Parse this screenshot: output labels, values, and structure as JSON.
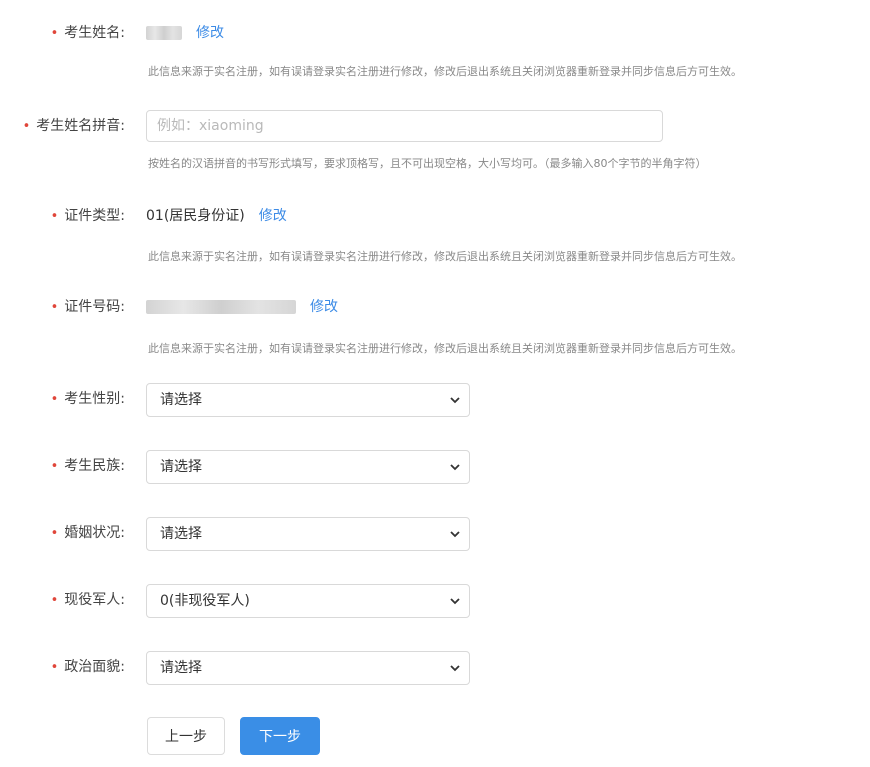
{
  "required_mark": "•",
  "name_row": {
    "label": "考生姓名:",
    "value_partial": "⁠忌",
    "edit_link": "修改",
    "hint": "此信息来源于实名注册，如有误请登录实名注册进行修改，修改后退出系统且关闭浏览器重新登录并同步信息后方可生效。"
  },
  "pinyin_row": {
    "label": "考生姓名拼音:",
    "placeholder": "例如：xiaoming",
    "hint": "按姓名的汉语拼音的书写形式填写，要求顶格写，且不可出现空格，大小写均可。（最多输入80个字节的半角字符）"
  },
  "id_type_row": {
    "label": "证件类型:",
    "value": "01(居民身份证)",
    "edit_link": "修改",
    "hint": "此信息来源于实名注册，如有误请登录实名注册进行修改，修改后退出系统且关闭浏览器重新登录并同步信息后方可生效。"
  },
  "id_number_row": {
    "label": "证件号码:",
    "edit_link": "修改",
    "hint": "此信息来源于实名注册，如有误请登录实名注册进行修改，修改后退出系统且关闭浏览器重新登录并同步信息后方可生效。"
  },
  "gender": {
    "label": "考生性别:",
    "selected": "请选择"
  },
  "ethnicity": {
    "label": "考生民族:",
    "selected": "请选择"
  },
  "marital": {
    "label": "婚姻状况:",
    "selected": "请选择"
  },
  "military": {
    "label": "现役军人:",
    "selected": "0(非现役军人)"
  },
  "political": {
    "label": "政治面貌:",
    "selected": "请选择"
  },
  "buttons": {
    "prev": "上一步",
    "next": "下一步"
  },
  "colors": {
    "required": "#e0463a",
    "link": "#3c8be6",
    "primary": "#3a8ee6"
  },
  "icons": {
    "select_arrow": "chevron-down-icon"
  }
}
